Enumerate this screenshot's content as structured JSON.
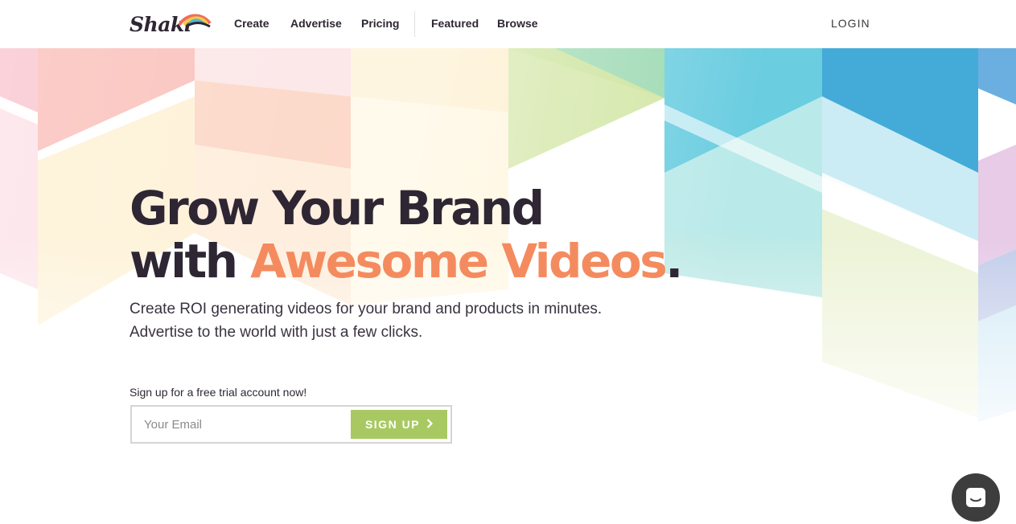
{
  "brand": {
    "name": "Shaki"
  },
  "nav": {
    "items": [
      {
        "label": "Create"
      },
      {
        "label": "Advertise"
      },
      {
        "label": "Pricing"
      },
      {
        "label": "Featured"
      },
      {
        "label": "Browse"
      }
    ],
    "login_label": "LOGIN"
  },
  "hero": {
    "headline_line1": "Grow Your Brand",
    "headline_line2_plain": "with ",
    "headline_line2_accent": "Awesome Videos",
    "headline_period": ".",
    "subtitle_line1": "Create ROI generating videos for your brand and products in minutes.",
    "subtitle_line2": "Advertise to the world with just a few clicks."
  },
  "signup": {
    "label": "Sign up for a free trial account now!",
    "email_placeholder": "Your Email",
    "email_value": "",
    "button_label": "SIGN UP",
    "button_icon": "chevron-right-icon"
  },
  "chat": {
    "icon": "chat-icon"
  },
  "colors": {
    "accent": "#f48b5f",
    "button": "#a8c961",
    "text": "#2e2633",
    "chat": "#3d3d3d"
  }
}
